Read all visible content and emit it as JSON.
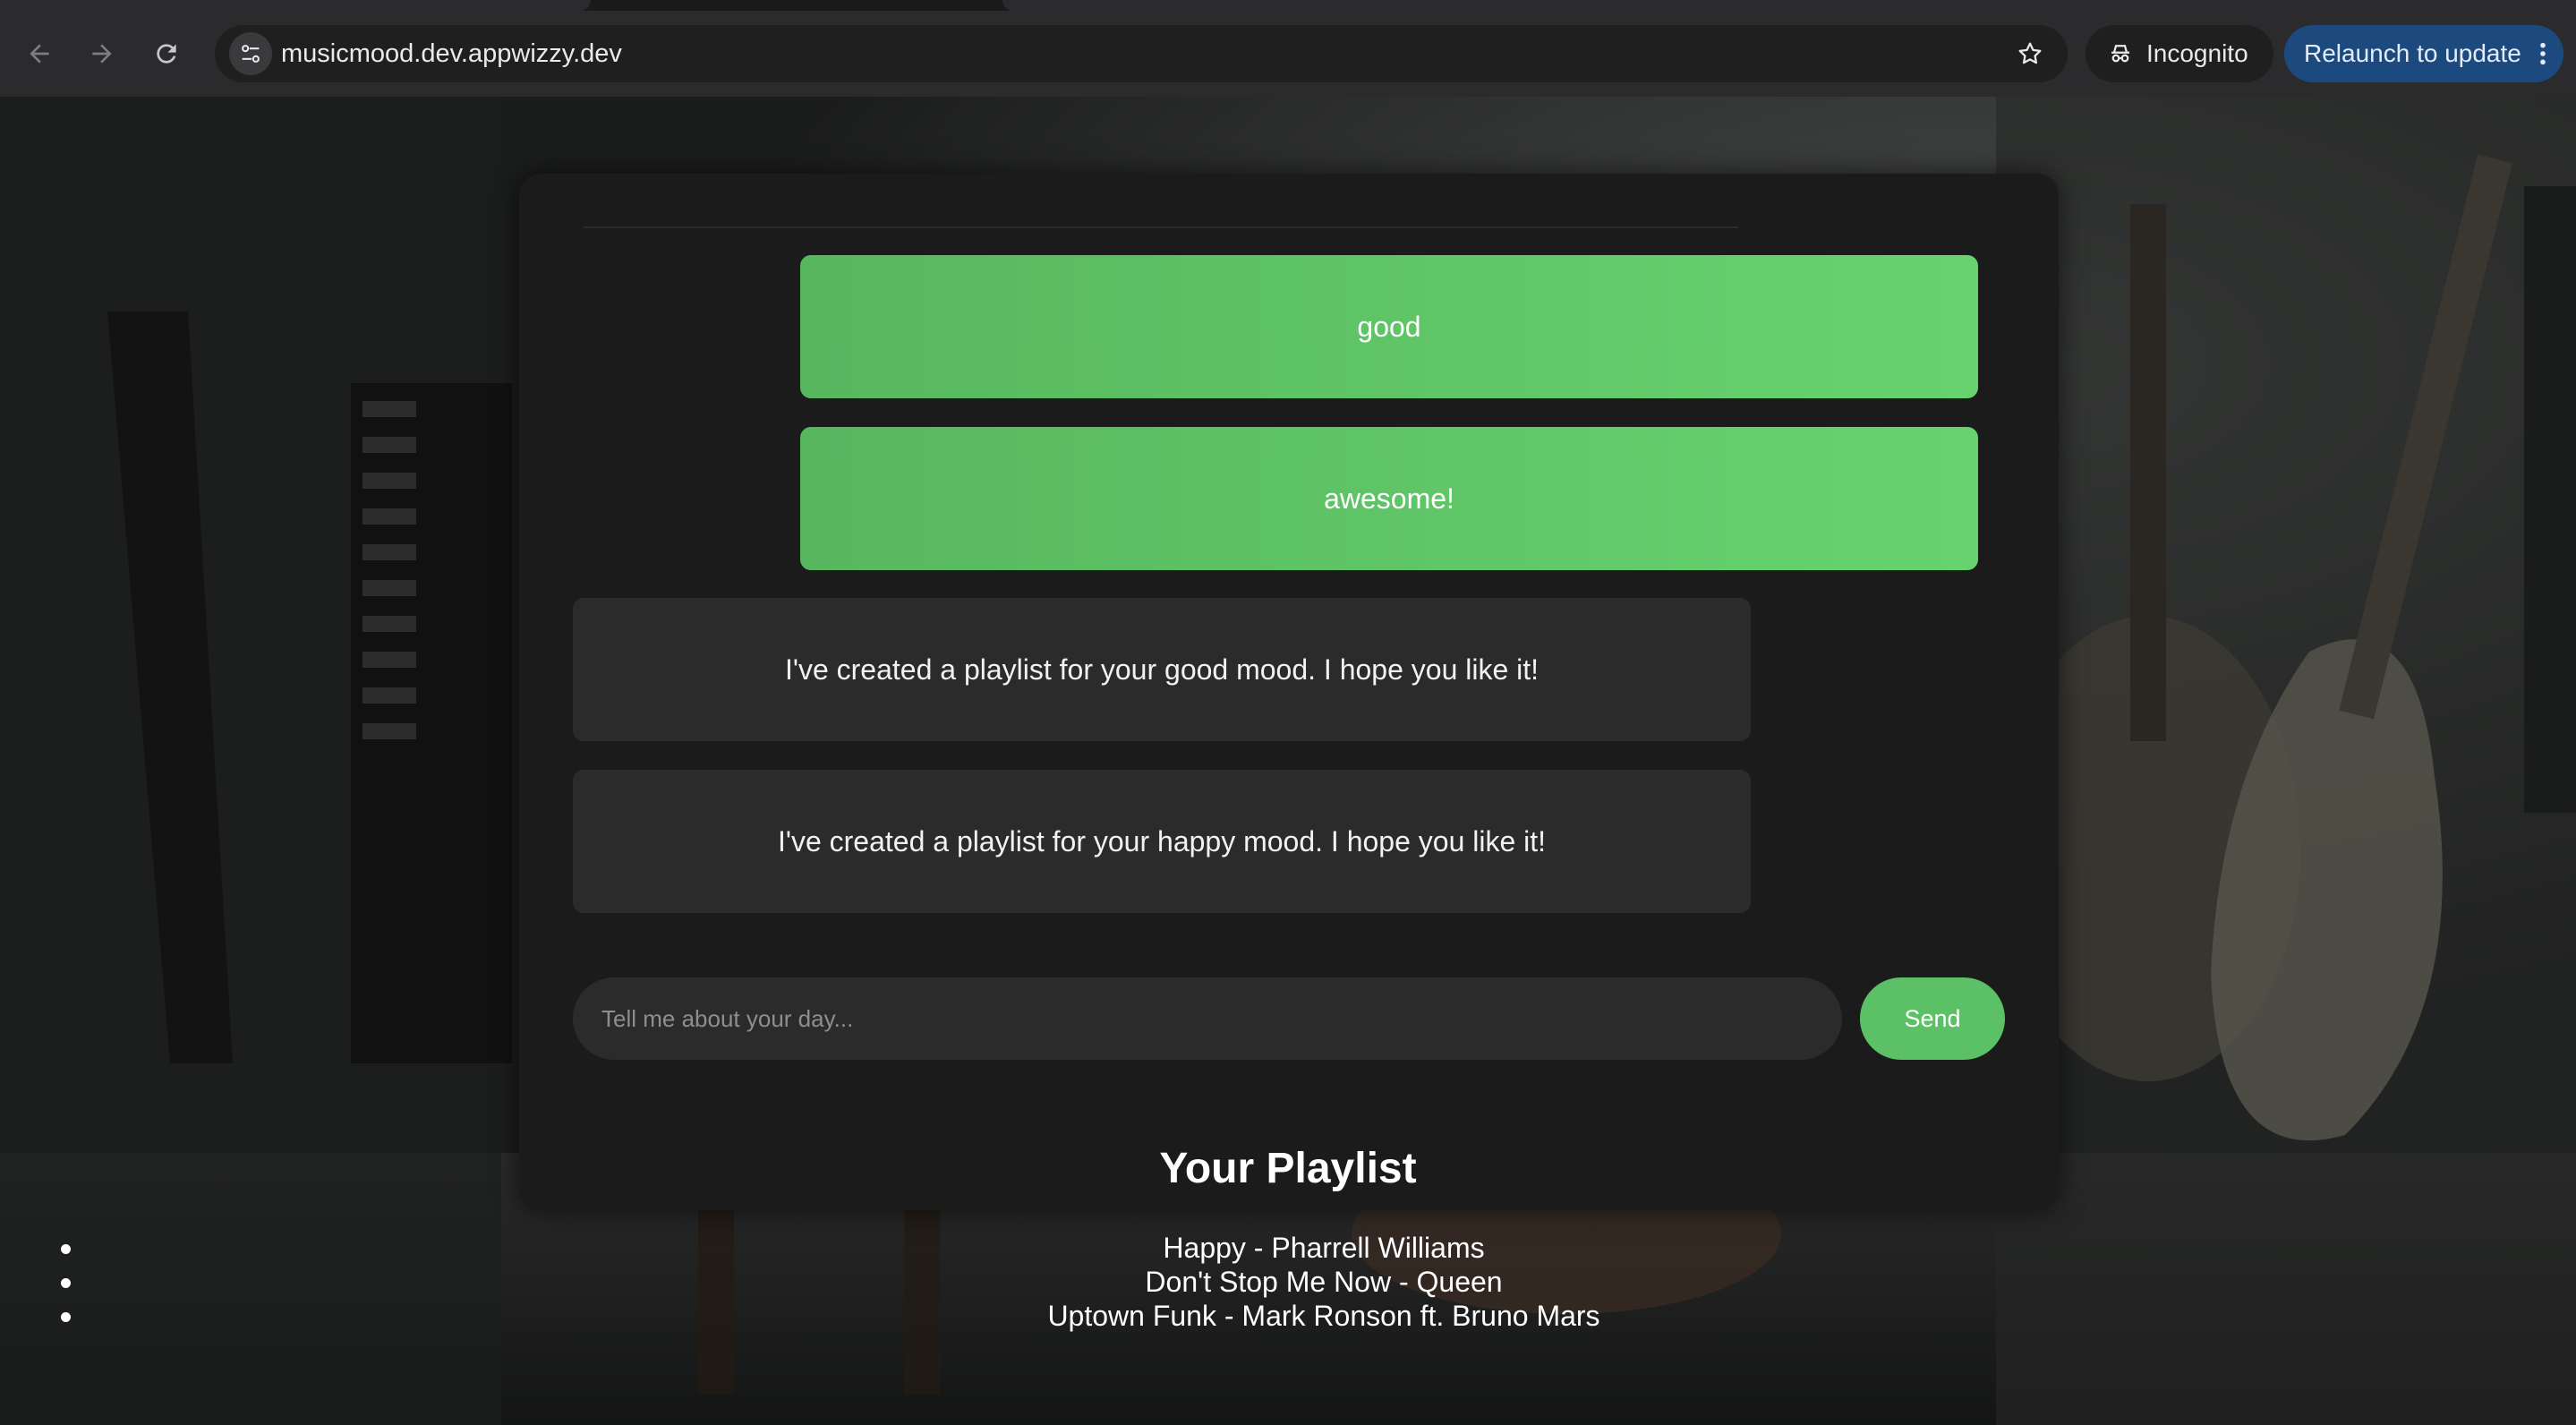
{
  "browser": {
    "url": "musicmood.dev.appwizzy.dev",
    "incognito_label": "Incognito",
    "relaunch_label": "Relaunch to update"
  },
  "page": {
    "chat": {
      "messages": [
        {
          "role": "user",
          "text": "good"
        },
        {
          "role": "user",
          "text": "awesome!"
        },
        {
          "role": "bot",
          "text": "I've created a playlist for your good mood. I hope you like it!"
        },
        {
          "role": "bot",
          "text": "I've created a playlist for your happy mood. I hope you like it!"
        }
      ],
      "input_placeholder": "Tell me about your day...",
      "send_label": "Send"
    },
    "playlist": {
      "title": "Your Playlist",
      "songs": [
        "Happy - Pharrell Williams",
        "Don't Stop Me Now - Queen",
        "Uptown Funk - Mark Ronson ft. Bruno Mars"
      ]
    }
  },
  "colors": {
    "accent_green": "#5cc066",
    "bot_bubble": "#2b2b2b",
    "panel": "#1b1b1b",
    "relaunch_blue": "#1c4a7e"
  },
  "icons": [
    "back-arrow-icon",
    "forward-arrow-icon",
    "reload-icon",
    "site-info-icon",
    "bookmark-star-icon",
    "incognito-icon",
    "more-vert-icon"
  ]
}
